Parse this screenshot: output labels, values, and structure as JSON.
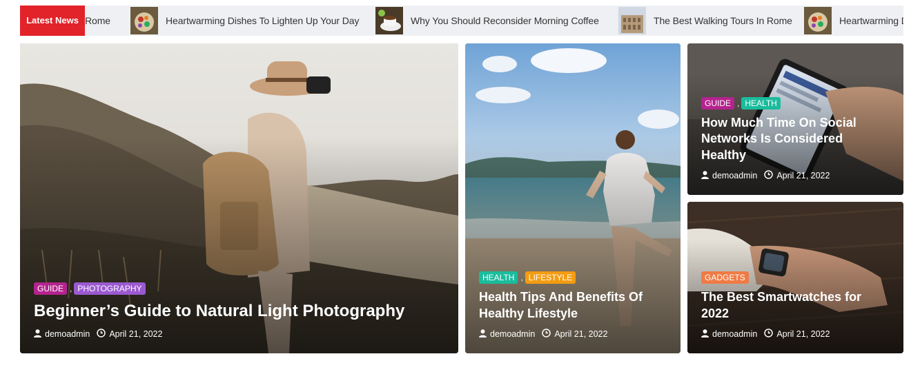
{
  "ticker": {
    "label": "Latest News",
    "items": [
      {
        "title": "Rome",
        "thumb": null
      },
      {
        "title": "Heartwarming Dishes To Lighten Up Your Day",
        "thumb": "food"
      },
      {
        "title": "Why You Should Reconsider Morning Coffee",
        "thumb": "coffee"
      },
      {
        "title": "The Best Walking Tours In Rome",
        "thumb": "rome"
      },
      {
        "title": "Heartwarming Dishes To Lighten Up Your Day",
        "thumb": "food"
      }
    ]
  },
  "cards": [
    {
      "categories": [
        {
          "name": "GUIDE",
          "color": "#b4238e"
        },
        {
          "name": "PHOTOGRAPHY",
          "color": "#9b59d0"
        }
      ],
      "title": "Beginner’s Guide to Natural Light Photography",
      "author": "demoadmin",
      "date": "April 21, 2022"
    },
    {
      "categories": [
        {
          "name": "HEALTH",
          "color": "#1abc9c"
        },
        {
          "name": "LIFESTYLE",
          "color": "#f39c12"
        }
      ],
      "title": "Health Tips And Benefits Of Healthy Lifestyle",
      "author": "demoadmin",
      "date": "April 21, 2022"
    },
    {
      "categories": [
        {
          "name": "GUIDE",
          "color": "#b4238e"
        },
        {
          "name": "HEALTH",
          "color": "#1abc9c"
        }
      ],
      "title": "How Much Time On Social Networks Is Considered Healthy",
      "author": "demoadmin",
      "date": "April 21, 2022"
    },
    {
      "categories": [
        {
          "name": "GADGETS",
          "color": "#ef7b45"
        }
      ],
      "title": "The Best Smartwatches for 2022",
      "author": "demoadmin",
      "date": "April 21, 2022"
    }
  ],
  "icons": {
    "author": "user-icon",
    "date": "clock-icon"
  },
  "colors": {
    "ticker_label_bg": "#e2232a",
    "ticker_bg": "#eef0f3"
  }
}
